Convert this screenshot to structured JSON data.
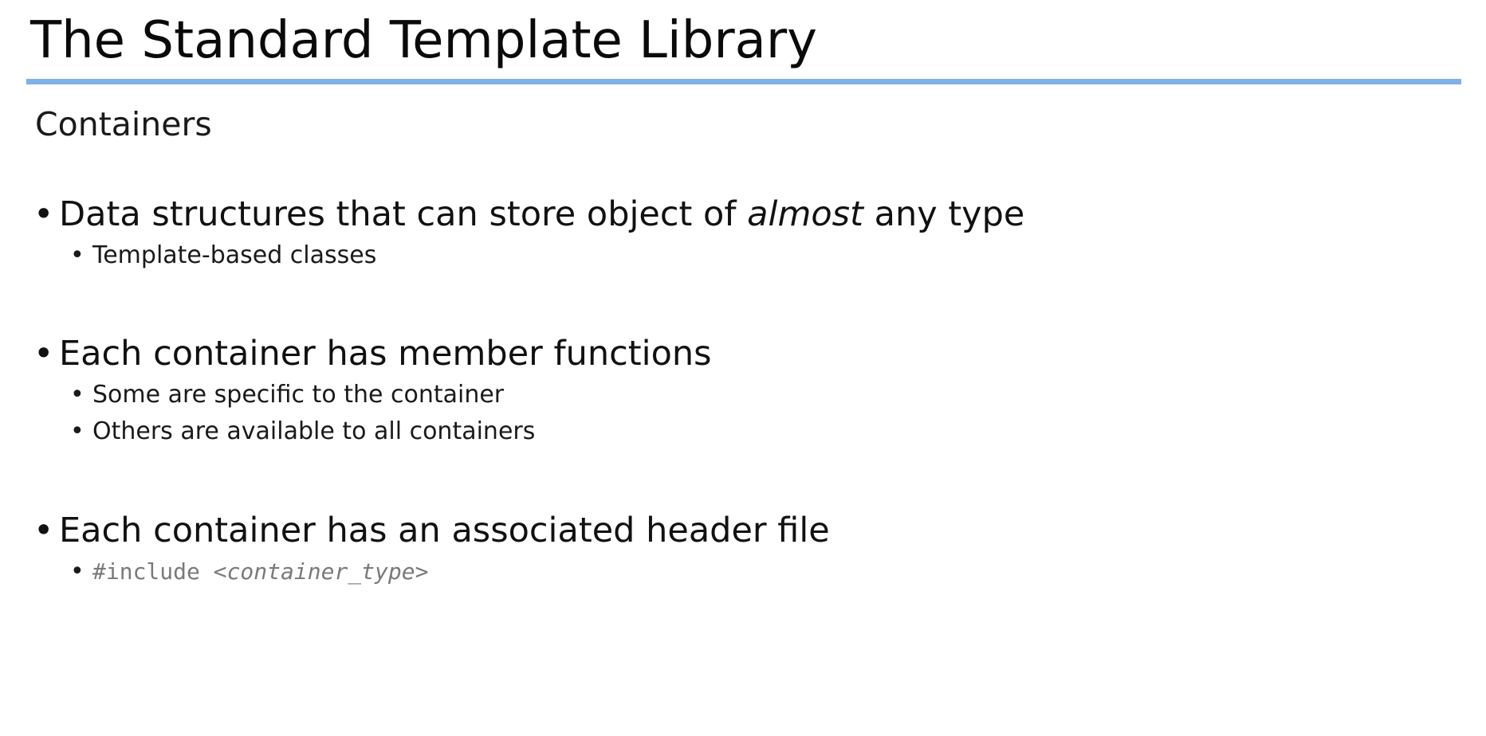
{
  "slide": {
    "title": "The Standard Template Library",
    "subtitle": "Containers",
    "bullet_glyph": "•",
    "accent_color": "#7fb0e8",
    "bullets": [
      {
        "text_before": "Data structures that can store object of ",
        "text_emphasis": "almost",
        "text_after": " any type",
        "subitems": [
          "Template-based classes"
        ]
      },
      {
        "text": "Each container has member functions",
        "subitems": [
          "Some are specific to the container",
          "Others are available to all containers"
        ]
      },
      {
        "text": "Each container has an associated header file",
        "code_prefix": "#include <",
        "code_emphasis": "container_type",
        "code_suffix": ">"
      }
    ]
  }
}
